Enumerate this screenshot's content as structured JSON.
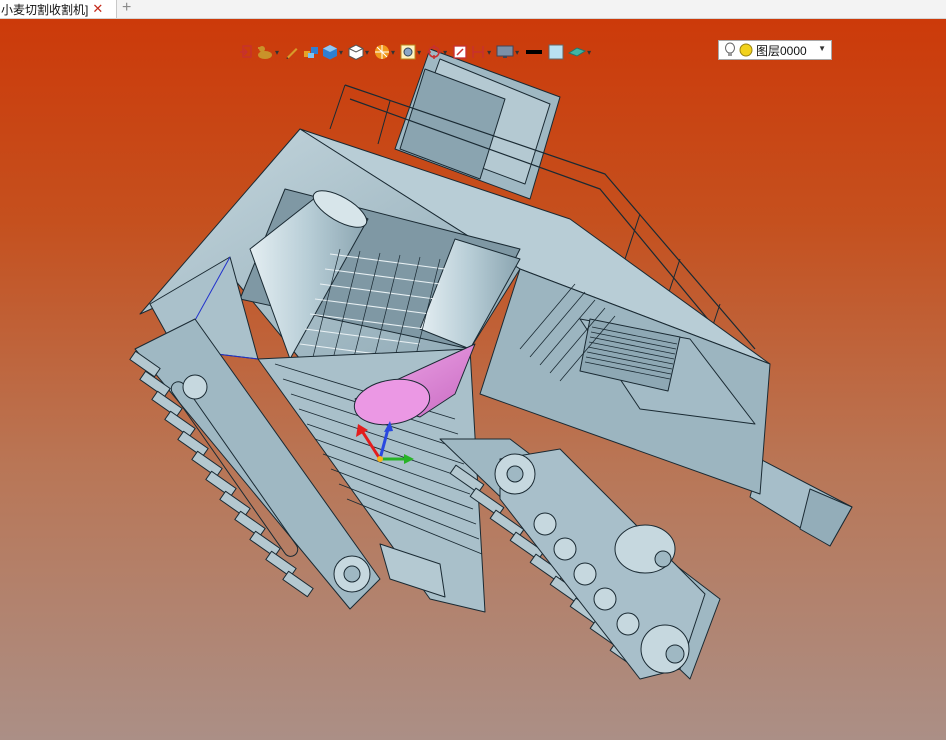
{
  "tab": {
    "title": "小麦切割收割机]",
    "close_glyph": "✕",
    "add_glyph": "+"
  },
  "toolbar": {
    "tools": [
      {
        "name": "snap-icon",
        "dropdown": false
      },
      {
        "name": "duck-filter-icon",
        "dropdown": true
      },
      {
        "name": "pen-icon",
        "dropdown": false
      },
      {
        "name": "multi-cube-icon",
        "dropdown": false
      },
      {
        "name": "shaded-cube-icon",
        "dropdown": true
      },
      {
        "name": "wire-cube-icon",
        "dropdown": true
      },
      {
        "name": "render-style-icon",
        "dropdown": true
      },
      {
        "name": "zoom-fit-icon",
        "dropdown": true
      },
      {
        "name": "pan-icon",
        "dropdown": true
      },
      {
        "name": "section-view-icon",
        "dropdown": false
      },
      {
        "name": "measure-icon",
        "dropdown": true
      },
      {
        "name": "display-monitor-icon",
        "dropdown": true
      },
      {
        "name": "line-color-icon",
        "dropdown": false
      },
      {
        "name": "fill-color-icon",
        "dropdown": false
      },
      {
        "name": "plane-icon",
        "dropdown": true
      }
    ],
    "layer": {
      "name": "图层0000",
      "status_colors": {
        "bulb": "#ffffff",
        "dot": "#f2d21b"
      }
    }
  },
  "viewport": {
    "model": "wheat-harvester-assembly",
    "colors": {
      "body": "#a9c2cd",
      "body_dark": "#8aa4b0",
      "body_light": "#c6d8df",
      "edge": "#1a2a33",
      "highlight_part": "#e88be0",
      "axis_x": "#e31d1d",
      "axis_y": "#27b327",
      "axis_z": "#2a48e0"
    }
  }
}
